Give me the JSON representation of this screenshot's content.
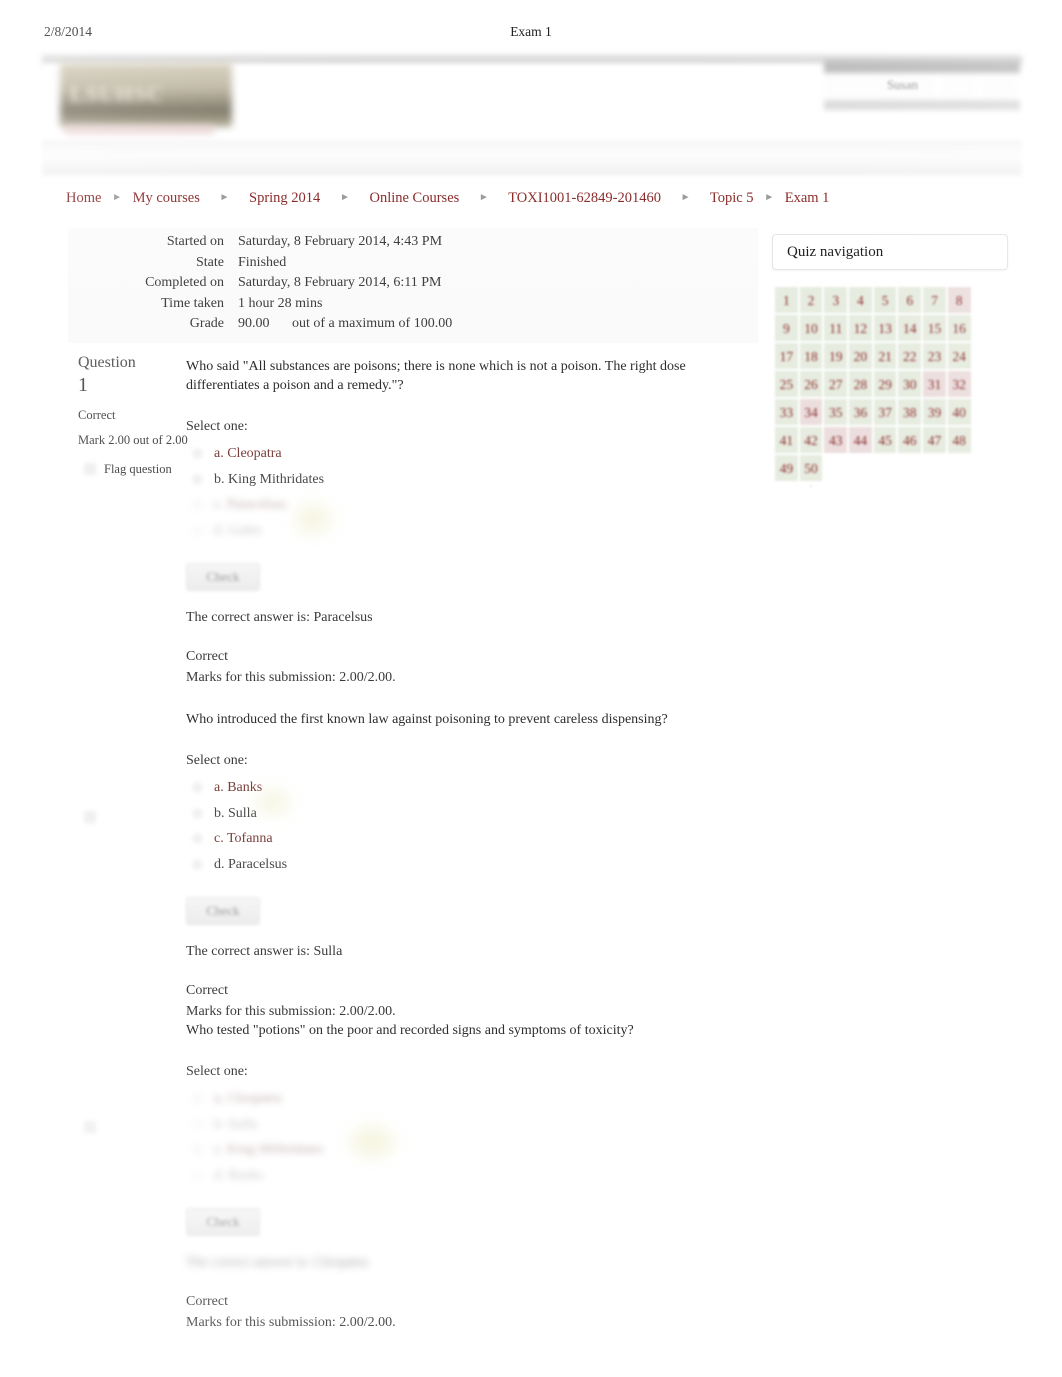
{
  "print_header": {
    "date": "2/8/2014",
    "title": "Exam 1"
  },
  "site": {
    "logo_text": "LSUHSC",
    "user_name": "Susan"
  },
  "breadcrumb": {
    "items": [
      "Home",
      "My courses",
      "Spring 2014",
      "Online Courses",
      "TOXI1001-62849-201460",
      "Topic 5",
      "Exam 1"
    ],
    "separator": "►"
  },
  "summary": {
    "rows": [
      {
        "label": "Started on",
        "value": "Saturday, 8 February 2014, 4:43 PM"
      },
      {
        "label": "State",
        "value": "Finished"
      },
      {
        "label": "Completed on",
        "value": "Saturday, 8 February 2014, 6:11 PM"
      },
      {
        "label": "Time taken",
        "value": "1 hour 28 mins"
      }
    ],
    "grade": {
      "label": "Grade",
      "score": "90.00",
      "out_of": "out of a maximum of 100.00"
    }
  },
  "questions": [
    {
      "info": {
        "question_word": "Question",
        "number": "1",
        "state": "Correct",
        "mark": "Mark 2.00 out of 2.00",
        "flag": "Flag question"
      },
      "text": "Who said \"All substances are poisons; there is none which is not a poison. The right dose differentiates a poison and a remedy.\"?",
      "select_one": "Select one:",
      "answers": [
        {
          "text": "a. Cleopatra",
          "style": "accent"
        },
        {
          "text": "b. King Mithridates",
          "style": "normal"
        },
        {
          "text": "c. Paracelsus",
          "style": "faded"
        },
        {
          "text": "d. Galen",
          "style": "faded2"
        }
      ],
      "check_label": "Check",
      "feedback": {
        "correct_answer": "The correct answer is: Paracelsus",
        "state": "Correct",
        "marks": "Marks for this submission: 2.00/2.00.",
        "answer_blurred": false
      }
    },
    {
      "info": {
        "question_word": "",
        "number": "",
        "state": "",
        "mark": "",
        "flag": ""
      },
      "text": "Who introduced the first known law against poisoning to prevent careless dispensing?",
      "select_one": "Select one:",
      "answers": [
        {
          "text": "a. Banks",
          "style": "accent"
        },
        {
          "text": "b. Sulla",
          "style": "normal"
        },
        {
          "text": "c. Tofanna",
          "style": "accent"
        },
        {
          "text": "d. Paracelsus",
          "style": "normal"
        }
      ],
      "check_label": "Check",
      "feedback": {
        "correct_answer": "The correct answer is: Sulla",
        "state": "Correct",
        "marks": "Marks for this submission: 2.00/2.00.",
        "answer_blurred": false
      }
    },
    {
      "info": {
        "question_word": "",
        "number": "",
        "state": "",
        "mark": "",
        "flag": ""
      },
      "text": "Who tested \"potions\" on the poor and recorded signs and symptoms of toxicity?",
      "select_one": "Select one:",
      "answers": [
        {
          "text": "a. Cleopatra",
          "style": "faded"
        },
        {
          "text": "b. Sulla",
          "style": "faded2"
        },
        {
          "text": "c. King Mithridates",
          "style": "faded"
        },
        {
          "text": "d. Banks",
          "style": "faded2"
        }
      ],
      "check_label": "Check",
      "feedback": {
        "correct_answer": "The correct answer is: Cleopatra",
        "state": "Correct",
        "marks": "Marks for this submission: 2.00/2.00.",
        "answer_blurred": true
      }
    }
  ],
  "quiz_navigation": {
    "title": "Quiz navigation",
    "numbers": [
      1,
      2,
      3,
      4,
      5,
      6,
      7,
      8,
      9,
      10,
      11,
      12,
      13,
      14,
      15,
      16,
      17,
      18,
      19,
      20,
      21,
      22,
      23,
      24,
      25,
      26,
      27,
      28,
      29,
      30,
      31,
      32,
      33,
      34,
      35,
      36,
      37,
      38,
      39,
      40,
      41,
      42,
      43,
      44,
      45,
      46,
      47,
      48,
      49,
      50
    ],
    "columns": 8,
    "cell_bg": "#e7ece0",
    "number_color": "#8b2e2e"
  }
}
